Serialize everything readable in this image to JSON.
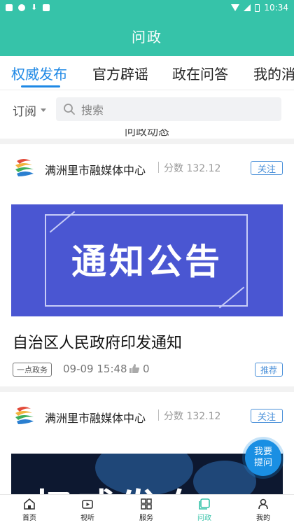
{
  "status_bar": {
    "time": "10:34"
  },
  "header": {
    "title": "问政"
  },
  "tabs": [
    {
      "label": "权威发布",
      "active": true
    },
    {
      "label": "官方辟谣",
      "active": false
    },
    {
      "label": "政在问答",
      "active": false
    },
    {
      "label": "我的消",
      "active": false
    }
  ],
  "search": {
    "subscribe_label": "订阅",
    "placeholder": "搜索"
  },
  "partial_card_text": "问政动态",
  "cards": [
    {
      "source": "满洲里市融媒体中心",
      "score": "分数 132.12",
      "follow_label": "关注",
      "banner_text": "通知公告",
      "headline": "自治区人民政府印发通知",
      "tag": "一点政务",
      "time": "09-09 15:48",
      "likes": "0",
      "recommend_label": "推荐"
    },
    {
      "source": "满洲里市融媒体中心",
      "score": "分数 132.12",
      "follow_label": "关注",
      "banner_text": "权威发布"
    }
  ],
  "ask_button": {
    "label": "我要提问"
  },
  "bottom_nav": [
    {
      "label": "首页",
      "icon": "home-icon",
      "active": false
    },
    {
      "label": "视听",
      "icon": "video-icon",
      "active": false
    },
    {
      "label": "服务",
      "icon": "grid-icon",
      "active": false
    },
    {
      "label": "问政",
      "icon": "question-icon",
      "active": true
    },
    {
      "label": "我的",
      "icon": "person-icon",
      "active": false
    }
  ],
  "colors": {
    "header": "#36c3a9",
    "accent_blue": "#1e88e5",
    "banner_blue": "#4a56d2"
  }
}
